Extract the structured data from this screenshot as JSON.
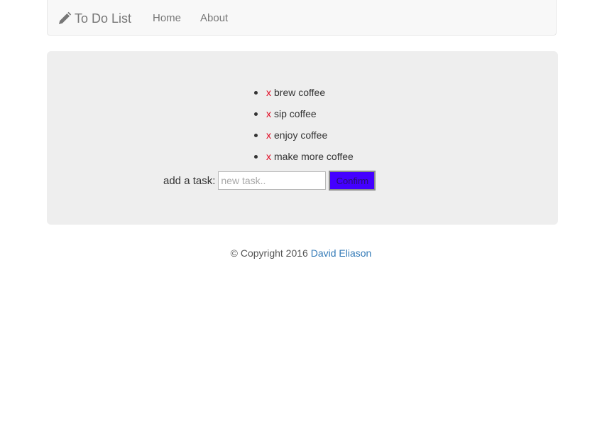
{
  "navbar": {
    "brand_icon": "pencil-icon",
    "brand": "To Do List",
    "links": [
      "Home",
      "About"
    ]
  },
  "todo": {
    "remove_glyph": "x",
    "tasks": [
      "brew coffee",
      "sip coffee",
      "enjoy coffee",
      "make more coffee"
    ],
    "add_label": "add a task:",
    "input_placeholder": "new task..",
    "input_value": "",
    "confirm_label": "Confirm"
  },
  "footer": {
    "copyright": "© Copyright 2016",
    "author": "David Eliason"
  },
  "colors": {
    "remove": "#e0001a",
    "confirm_bg": "#4400ff",
    "link": "#337ab7",
    "panel_bg": "#eeeeee",
    "navbar_bg": "#f8f8f8"
  }
}
